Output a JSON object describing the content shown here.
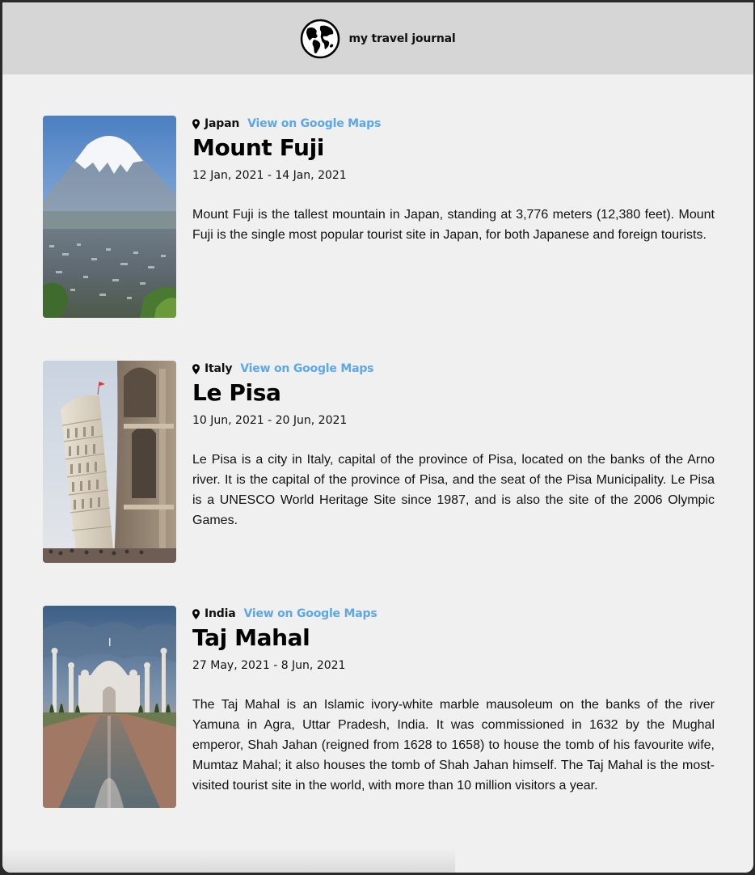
{
  "header": {
    "brand": "my travel journal",
    "logo_icon": "globe-icon"
  },
  "colors": {
    "header_bg": "#d6d6d6",
    "page_bg": "#f0f0f0",
    "link": "#5aa7ec"
  },
  "entries": [
    {
      "country": "Japan",
      "maps_label": "View on Google Maps",
      "title": "Mount Fuji",
      "dates": "12 Jan, 2021 - 14 Jan, 2021",
      "description": "Mount Fuji is the tallest mountain in Japan, standing at 3,776 meters (12,380 feet). Mount Fuji is the single most popular tourist site in Japan, for both Japanese and foreign tourists."
    },
    {
      "country": "Italy",
      "maps_label": "View on Google Maps",
      "title": "Le Pisa",
      "dates": "10 Jun, 2021 - 20 Jun, 2021",
      "description": "Le Pisa is a city in Italy, capital of the province of Pisa, located on the banks of the Arno river. It is the capital of the province of Pisa, and the seat of the Pisa Municipality. Le Pisa is a UNESCO World Heritage Site since 1987, and is also the site of the 2006 Olympic Games."
    },
    {
      "country": "India",
      "maps_label": "View on Google Maps",
      "title": "Taj Mahal",
      "dates": "27 May, 2021 - 8 Jun, 2021",
      "description": "The Taj Mahal is an Islamic ivory-white marble mausoleum on the banks of the river Yamuna in Agra, Uttar Pradesh, India. It was commissioned in 1632 by the Mughal emperor, Shah Jahan (reigned from 1628 to 1658) to house the tomb of his favourite wife, Mumtaz Mahal; it also houses the tomb of Shah Jahan himself. The Taj Mahal is the most-visited tourist site in the world, with more than 10 million visitors a year."
    }
  ]
}
